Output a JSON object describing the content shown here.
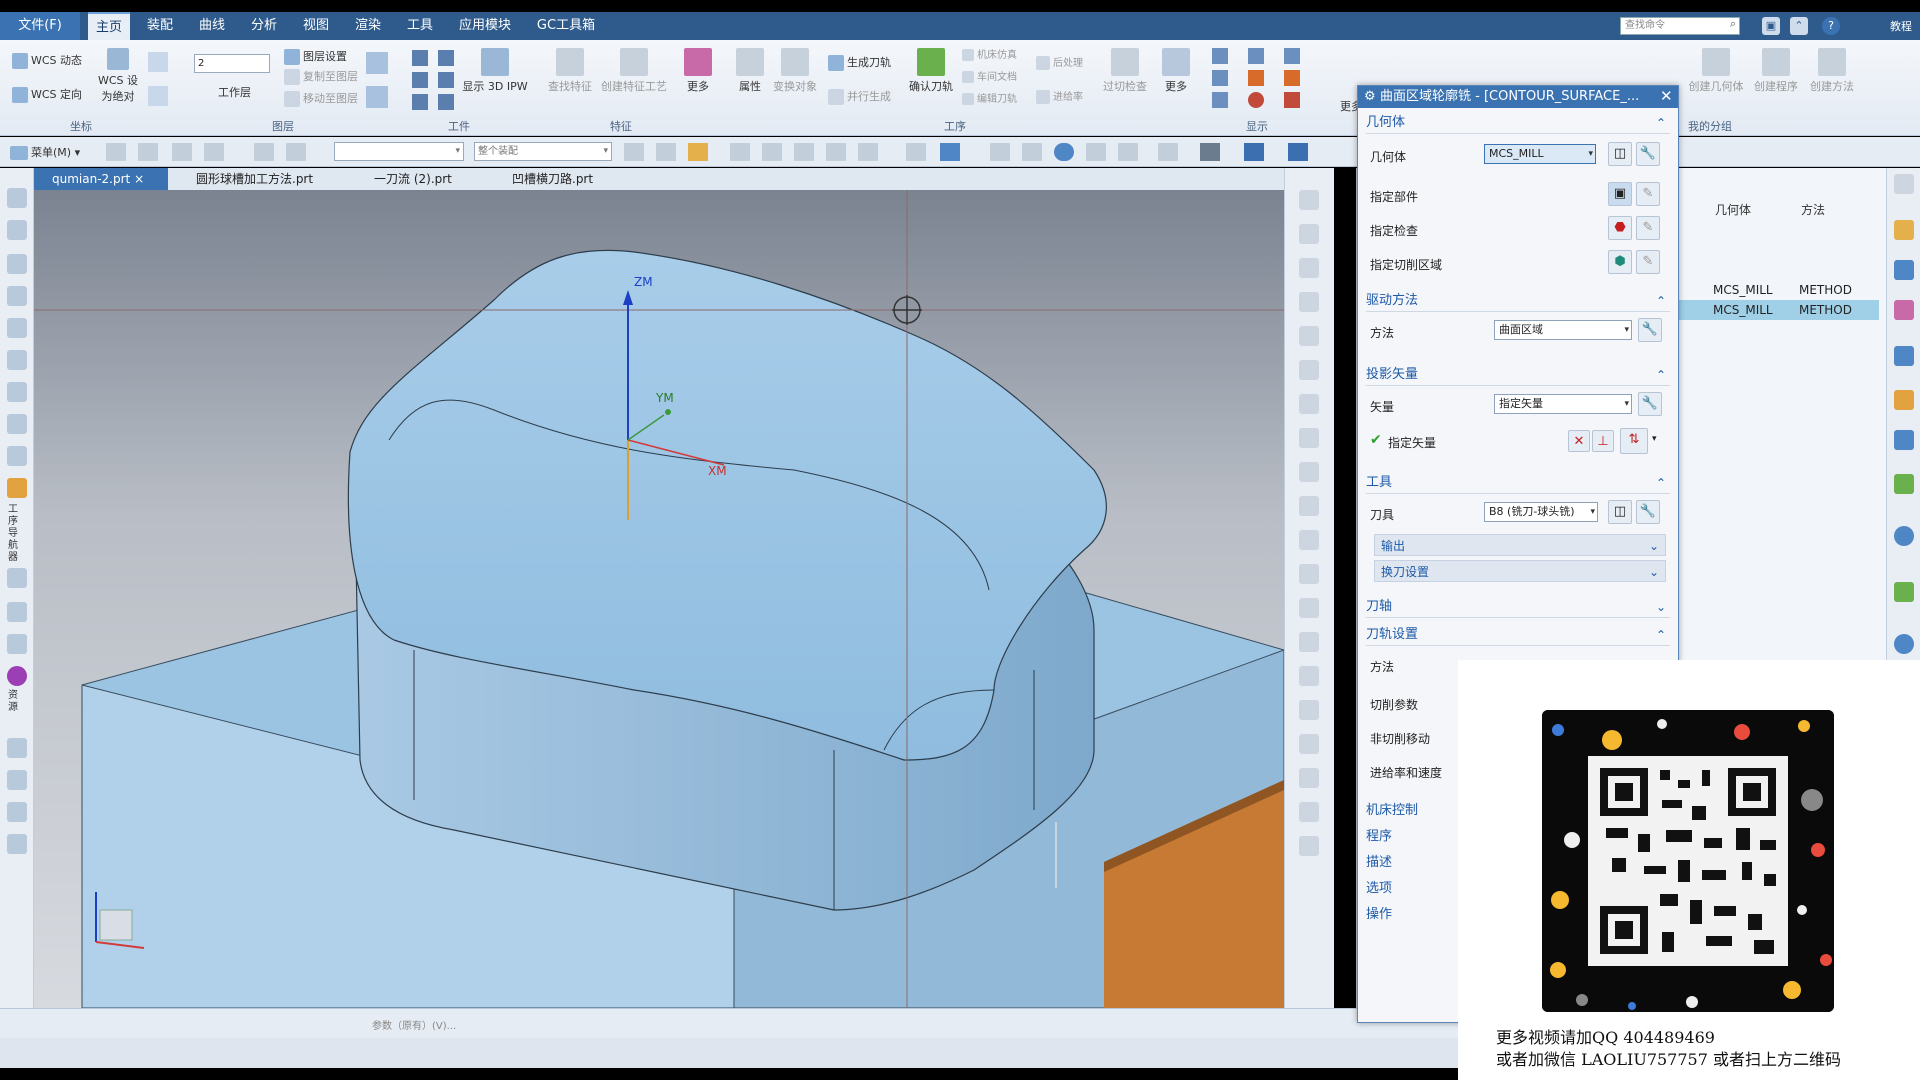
{
  "menu": {
    "file": "文件(F)",
    "items": [
      "主页",
      "装配",
      "曲线",
      "分析",
      "视图",
      "渲染",
      "工具",
      "应用模块",
      "GC工具箱"
    ],
    "search_placeholder": "查找命令",
    "help_label": "教程"
  },
  "ribbon": {
    "groups": [
      "坐标",
      "图层",
      "工件",
      "特征",
      "工序",
      "显示",
      "我的分组"
    ],
    "coord": {
      "wcs_dynamic": "WCS 动态",
      "wcs_orient": "WCS 定向",
      "wcs_abs_1": "WCS 设",
      "wcs_abs_2": "为绝对"
    },
    "layer": {
      "value": "2",
      "work_layer": "工作层",
      "layer_settings": "图层设置",
      "copy_to_layer": "复制至图层",
      "move_to_layer": "移动至图层"
    },
    "workpiece": {
      "show_ipw": "显示 3D IPW"
    },
    "feature": {
      "find_feature": "查找特征",
      "create_feature_process": "创建特征工艺",
      "more": "更多"
    },
    "operation": {
      "properties": "属性",
      "transform_object": "变换对象",
      "generate_toolpath": "生成刀轨",
      "parallel_generate": "并行生成",
      "verify_toolpath": "确认刀轨",
      "machine_sim": "机床仿真",
      "shop_doc": "车间文档",
      "edit_toolpath": "编辑刀轨",
      "post_process": "后处理",
      "feed_rate": "进给率",
      "overcut_check": "过切检查",
      "more": "更多"
    },
    "my_group": {
      "create_geometry": "创建几何体",
      "create_program": "创建程序",
      "create_method": "创建方法"
    },
    "more_label": "更多"
  },
  "toolbar2": {
    "menu_label": "菜单(M)",
    "filter_placeholder": "",
    "assembly_scope": "整个装配"
  },
  "tabs": [
    {
      "label": "qumian-2.prt",
      "active": true
    },
    {
      "label": "圆形球槽加工方法.prt"
    },
    {
      "label": "一刀流 (2).prt"
    },
    {
      "label": "凹槽横刀路.prt"
    }
  ],
  "viewport": {
    "zm": "ZM",
    "ym": "YM",
    "xm": "XM"
  },
  "left_sidebar": {
    "label_1": "工序导航器",
    "label_2": "资源"
  },
  "status": {
    "param_label": "参数（原有）(V)..."
  },
  "navigator": {
    "columns": [
      "几何体",
      "方法"
    ],
    "rows": [
      {
        "geometry": "MCS_MILL",
        "method": "METHOD",
        "selected": false
      },
      {
        "geometry": "MCS_MILL",
        "method": "METHOD",
        "selected": true
      }
    ]
  },
  "dialog": {
    "title": "曲面区域轮廓铣 - [CONTOUR_SURFACE_...",
    "geometry": {
      "header": "几何体",
      "label": "几何体",
      "value": "MCS_MILL",
      "specify_part": "指定部件",
      "specify_check": "指定检查",
      "specify_cut_area": "指定切削区域"
    },
    "drive": {
      "header": "驱动方法",
      "label": "方法",
      "value": "曲面区域"
    },
    "projection": {
      "header": "投影矢量",
      "label": "矢量",
      "value": "指定矢量",
      "specify_vector": "指定矢量"
    },
    "tool": {
      "header": "工具",
      "label": "刀具",
      "value": "B8 (铣刀-球头铣)",
      "output": "输出",
      "tool_change": "换刀设置"
    },
    "tool_axis": {
      "header": "刀轴"
    },
    "path_settings": {
      "header": "刀轨设置",
      "method": "方法",
      "cut_params": "切削参数",
      "non_cut": "非切削移动",
      "feeds": "进给率和速度"
    },
    "machine_control": "机床控制",
    "program": "程序",
    "description": "描述",
    "options": "选项",
    "actions": "操作"
  },
  "promo": {
    "line1": "更多视频请加QQ 404489469",
    "line2": "或者加微信 LAOLIU757757 或者扫上方二维码"
  }
}
